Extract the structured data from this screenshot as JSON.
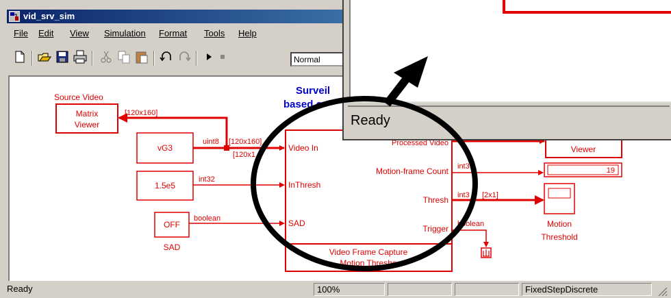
{
  "window": {
    "title": "vid_srv_sim",
    "colors": {
      "accent": "#e00000",
      "titlebar": "#0a246a",
      "face": "#d4d0c8",
      "annotation_title": "#0000cc"
    }
  },
  "menu": [
    "File",
    "Edit",
    "View",
    "Simulation",
    "Format",
    "Tools",
    "Help"
  ],
  "toolbar": {
    "icons": [
      "new-icon",
      "open-icon",
      "save-icon",
      "print-icon",
      "cut-icon",
      "copy-icon",
      "paste-icon",
      "undo-icon",
      "redo-icon",
      "play-icon",
      "stop-icon"
    ],
    "sim_mode": "Normal"
  },
  "model": {
    "title_line1": "Surveil",
    "title_line2": "based o",
    "source_video_label": "Source Video",
    "matrix_viewer_line1": "Matrix",
    "matrix_viewer_line2": "Viewer",
    "vg3": "vG3",
    "thresh_const": "1.5e5",
    "sad_const": "OFF",
    "sad_caption": "SAD",
    "sig_uint8": "uint8",
    "sig_dim_a": "[120x160]",
    "sig_dim_b": "[120x160]",
    "sig_dim_c": "[120x1",
    "sig_int32_in": "int32",
    "sig_boolean_in": "boolean",
    "port_video_in": "Video In",
    "port_inthresh": "InThresh",
    "port_sad": "SAD",
    "port_processed_video": "Processed Video",
    "port_motion_frame_count": "Motion-frame Count",
    "port_thresh": "Thresh",
    "port_trigger": "Trigger",
    "subsys_line1": "Video Frame Capture",
    "subsys_line2": "Motion Thresho",
    "out_int3_a": "int3",
    "out_int3_b": "int3",
    "out_dim": "[2x1]",
    "out_boolean": "boolean",
    "viewer_label": "Viewer",
    "display_value": "19",
    "motion_threshold_line1": "Motion",
    "motion_threshold_line2": "Threshold"
  },
  "popup": {
    "status": "Ready"
  },
  "status": {
    "left": "Ready",
    "zoom": "100%",
    "solver": "FixedStepDiscrete"
  }
}
